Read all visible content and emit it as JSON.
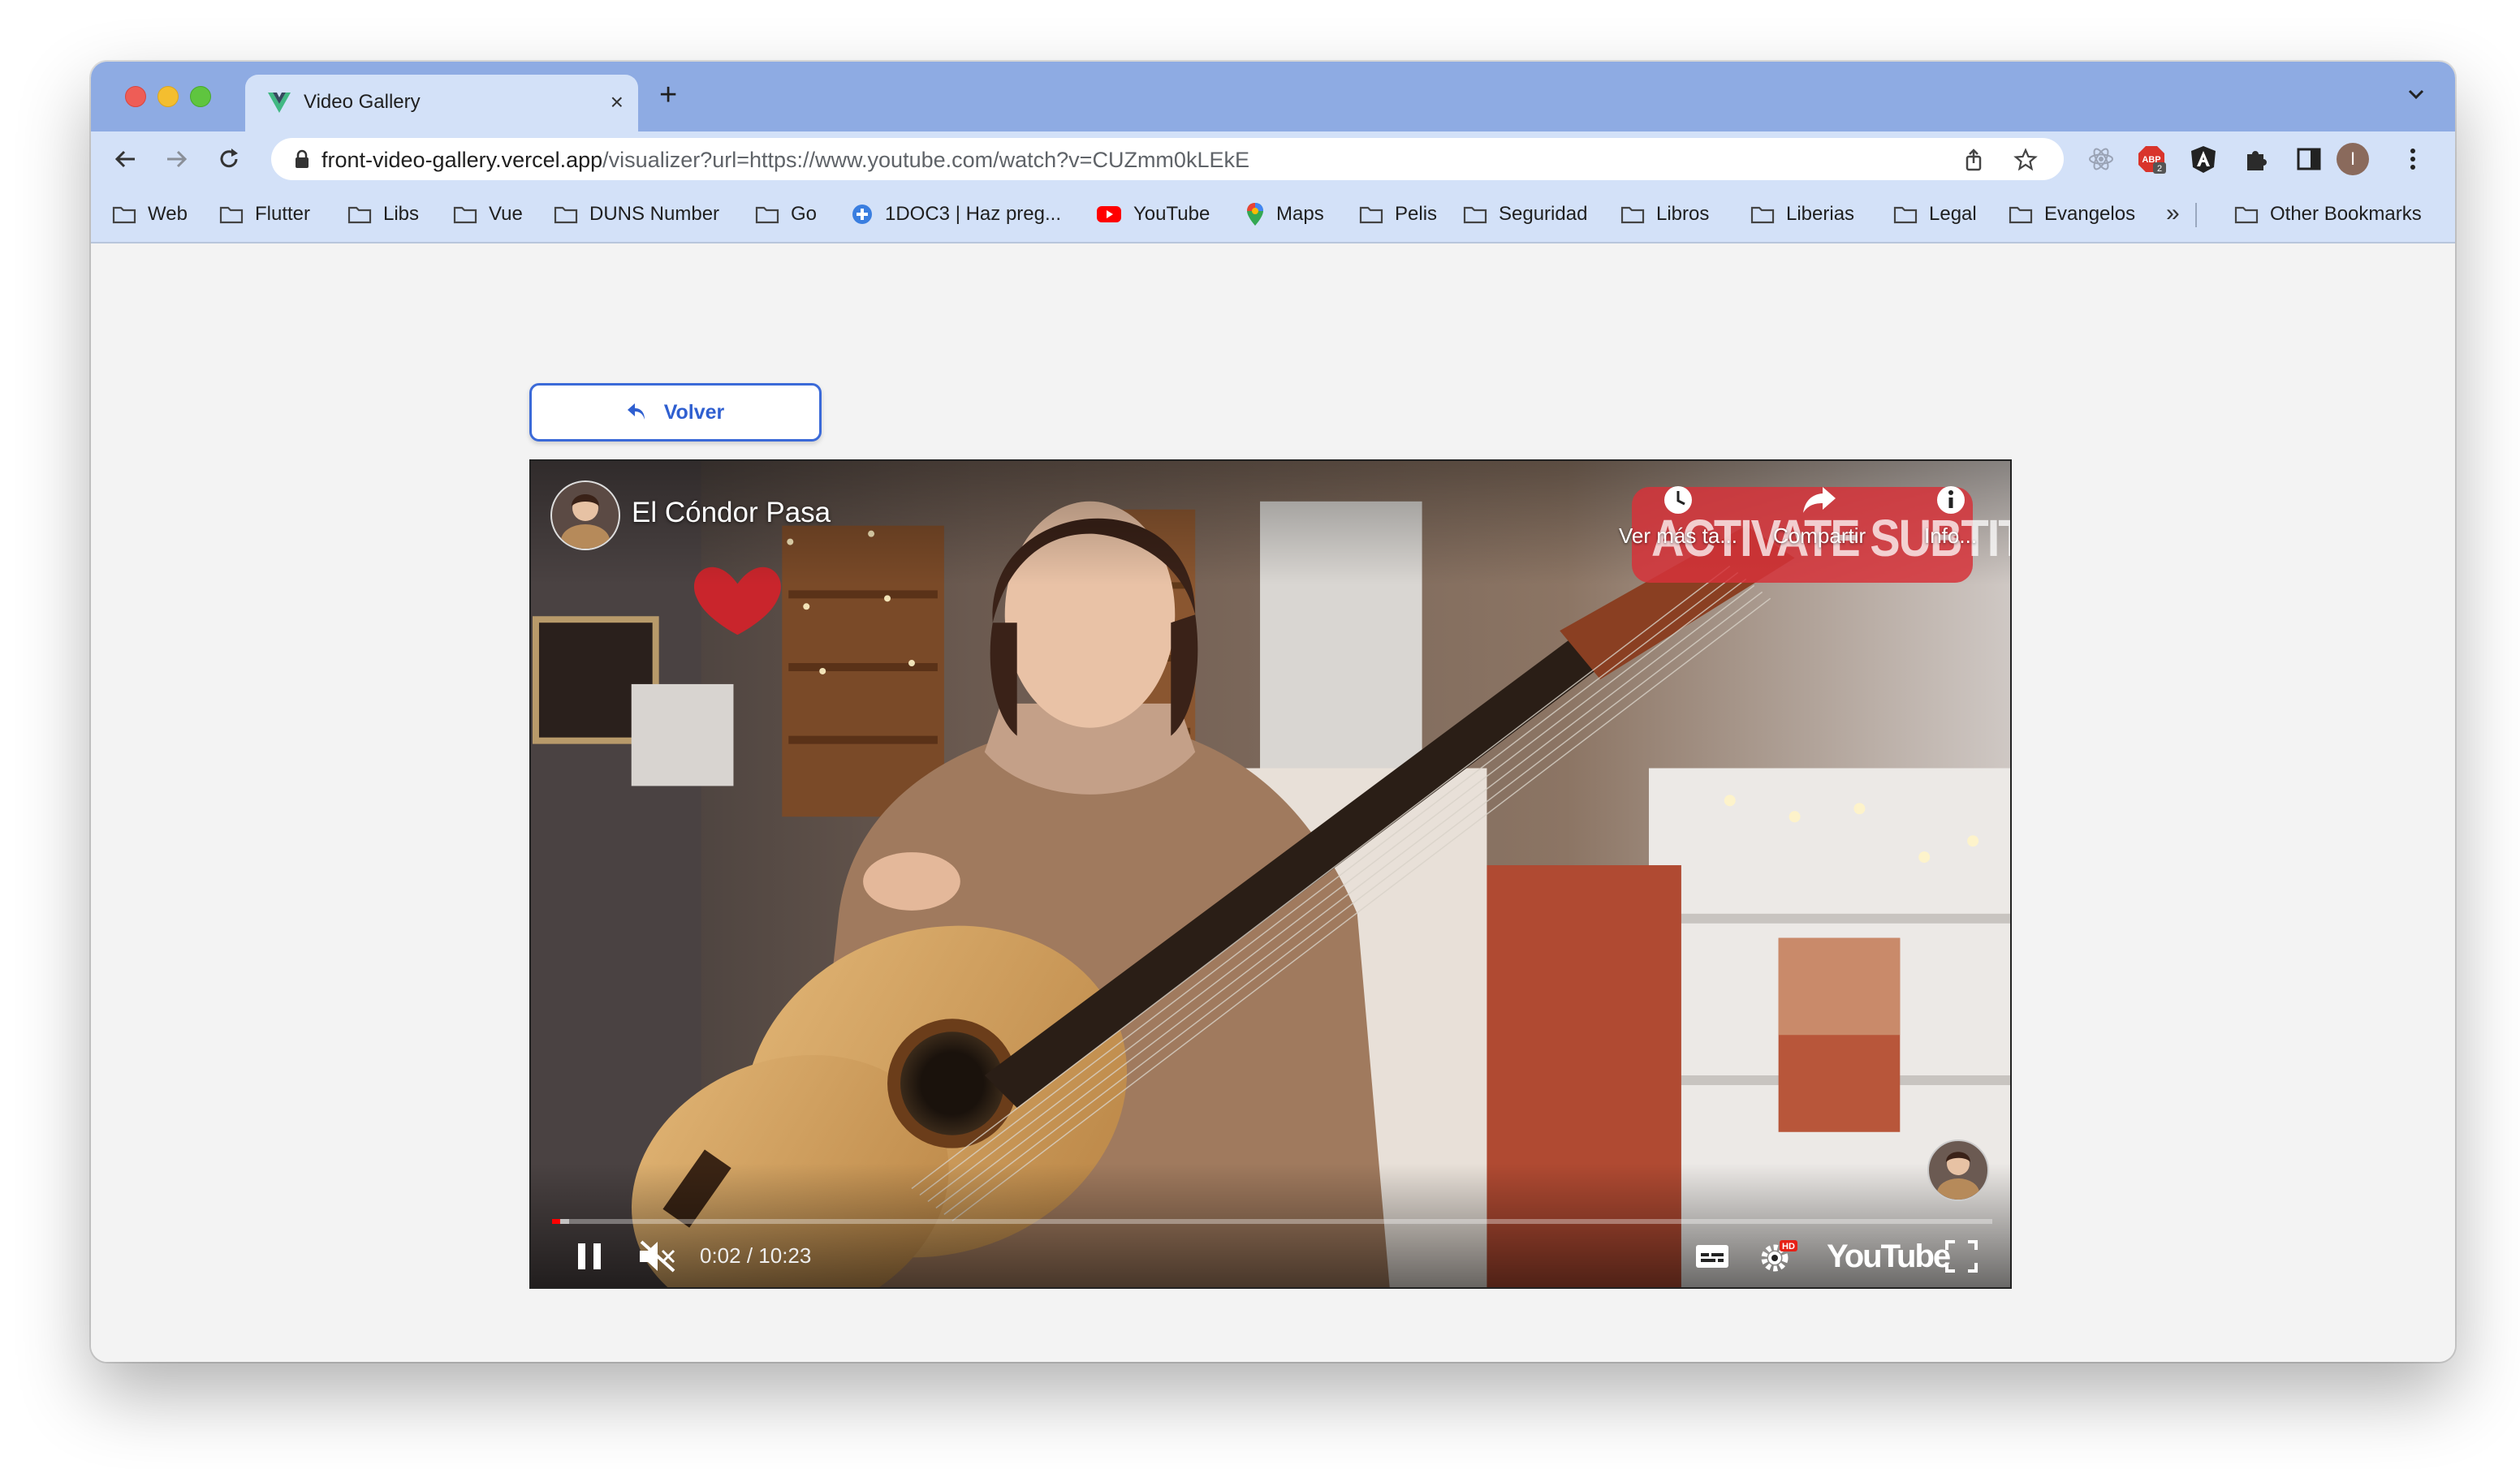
{
  "browser": {
    "tab_title": "Video Gallery",
    "new_tab_label": "+",
    "tab_close_label": "×",
    "url_host": "front-video-gallery.vercel.app",
    "url_path": "/visualizer?url=https://www.youtube.com/watch?v=CUZmm0kLEkE",
    "profile_initial": "I",
    "extension_badge": "2"
  },
  "bookmarks": {
    "items": [
      {
        "label": "Web",
        "icon": "folder-icon"
      },
      {
        "label": "Flutter",
        "icon": "folder-icon"
      },
      {
        "label": "Libs",
        "icon": "folder-icon"
      },
      {
        "label": "Vue",
        "icon": "folder-icon"
      },
      {
        "label": "DUNS Number",
        "icon": "folder-icon"
      },
      {
        "label": "Go",
        "icon": "folder-icon"
      },
      {
        "label": "1DOC3 | Haz preg...",
        "icon": "plus-circle-icon"
      },
      {
        "label": "YouTube",
        "icon": "youtube-icon"
      },
      {
        "label": "Maps",
        "icon": "maps-pin-icon"
      },
      {
        "label": "Pelis",
        "icon": "folder-icon"
      },
      {
        "label": "Seguridad",
        "icon": "folder-icon"
      },
      {
        "label": "Libros",
        "icon": "folder-icon"
      },
      {
        "label": "Liberias",
        "icon": "folder-icon"
      },
      {
        "label": "Legal",
        "icon": "folder-icon"
      },
      {
        "label": "Evangelos",
        "icon": "folder-icon"
      }
    ],
    "more_label": "»",
    "other_label": "Other Bookmarks"
  },
  "page": {
    "back_label": "Volver"
  },
  "video": {
    "title": "El Cóndor Pasa",
    "overlay_sign": "ACTIVATE SUBTITLES",
    "actions": {
      "watch_later": "Ver más ta...",
      "share": "Compartir",
      "info": "Info..."
    },
    "current_time": "0:02",
    "duration": "10:23",
    "time_display": "0:02 / 10:23",
    "progress_fraction": 0.0032,
    "buffer_fraction": 0.012,
    "muted": true,
    "playing": true,
    "quality_badge": "HD",
    "brand": "YouTube"
  },
  "colors": {
    "tabstrip": "#8eabe3",
    "toolbar": "#d3e1f8",
    "accent": "#2f5fd0",
    "progress": "#ff0000"
  }
}
